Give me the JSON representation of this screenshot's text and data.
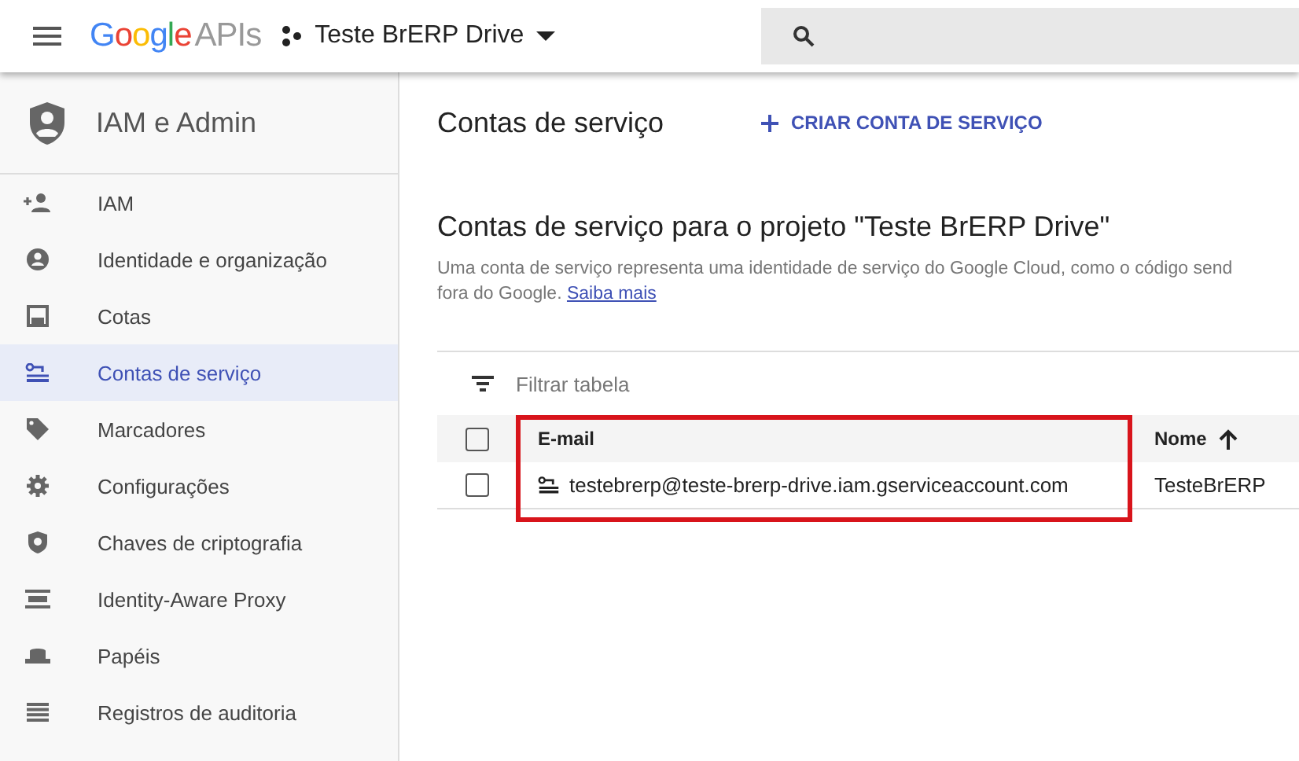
{
  "topbar": {
    "logo_word": "Google",
    "logo_suffix": "APIs",
    "project": "Teste BrERP Drive"
  },
  "sidebar": {
    "title": "IAM e Admin",
    "items": [
      {
        "label": "IAM",
        "kind": "person-add",
        "selected": false
      },
      {
        "label": "Identidade e organização",
        "kind": "account",
        "selected": false
      },
      {
        "label": "Cotas",
        "kind": "quota",
        "selected": false
      },
      {
        "label": "Contas de serviço",
        "kind": "service",
        "selected": true
      },
      {
        "label": "Marcadores",
        "kind": "tag",
        "selected": false
      },
      {
        "label": "Configurações",
        "kind": "gear",
        "selected": false
      },
      {
        "label": "Chaves de criptografia",
        "kind": "shield",
        "selected": false
      },
      {
        "label": "Identity-Aware Proxy",
        "kind": "proxy",
        "selected": false
      },
      {
        "label": "Papéis",
        "kind": "hat",
        "selected": false
      },
      {
        "label": "Registros de auditoria",
        "kind": "list",
        "selected": false
      }
    ]
  },
  "main": {
    "title": "Contas de serviço",
    "create_button": "CRIAR CONTA DE SERVIÇO",
    "section_title": "Contas de serviço para o projeto \"Teste BrERP Drive\"",
    "description_lines": [
      "Uma conta de serviço representa uma identidade de serviço do Google Cloud, como o código send",
      "fora do Google."
    ],
    "learn_more": "Saiba mais",
    "filter_placeholder": "Filtrar tabela",
    "table": {
      "columns": [
        {
          "label": "E-mail",
          "highlighted": true,
          "sorted": false
        },
        {
          "label": "Nome",
          "highlighted": false,
          "sorted": true
        }
      ],
      "rows": [
        {
          "checked": false,
          "email": "testebrerp@teste-brerp-drive.iam.gserviceaccount.com",
          "name": "TesteBrERP"
        }
      ],
      "header_checked": false
    }
  }
}
